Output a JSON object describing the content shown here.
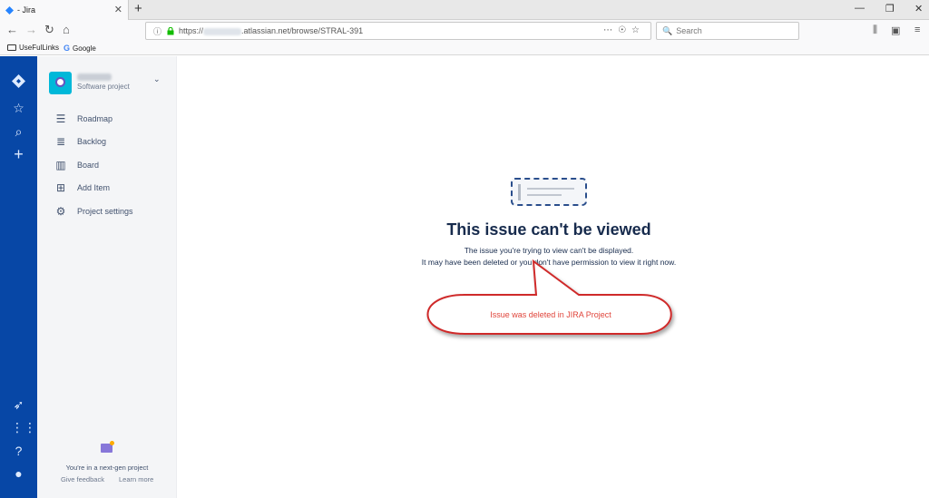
{
  "browser": {
    "tab_title": "- Jira",
    "url_prefix": "https://",
    "url_suffix": ".atlassian.net/browse/STRAL-391",
    "search_placeholder": "Search",
    "bookmarks": [
      "UseFulLinks",
      "Google"
    ],
    "colors": {
      "chrome": "#f9f9fa",
      "tabstrip": "#e8e8e8"
    }
  },
  "sidebar": {
    "project_type": "Software project",
    "items": [
      {
        "label": "Roadmap",
        "icon": "roadmap-icon"
      },
      {
        "label": "Backlog",
        "icon": "backlog-icon"
      },
      {
        "label": "Board",
        "icon": "board-icon"
      },
      {
        "label": "Add Item",
        "icon": "add-item-icon"
      },
      {
        "label": "Project settings",
        "icon": "gear-icon"
      }
    ],
    "footer_text": "You're in a next-gen project",
    "give_feedback": "Give feedback",
    "learn_more": "Learn more"
  },
  "main": {
    "title": "This issue can't be viewed",
    "line1": "The issue you're trying to view can't be displayed.",
    "line2": "It may have been deleted or you don't have permission to view it right now."
  },
  "annotation": {
    "text": "Issue was deleted  in JIRA Project",
    "color": "#e0443a"
  },
  "colors": {
    "global_nav": "#0747a6",
    "sidebar": "#f4f5f7",
    "text": "#172b4d"
  }
}
